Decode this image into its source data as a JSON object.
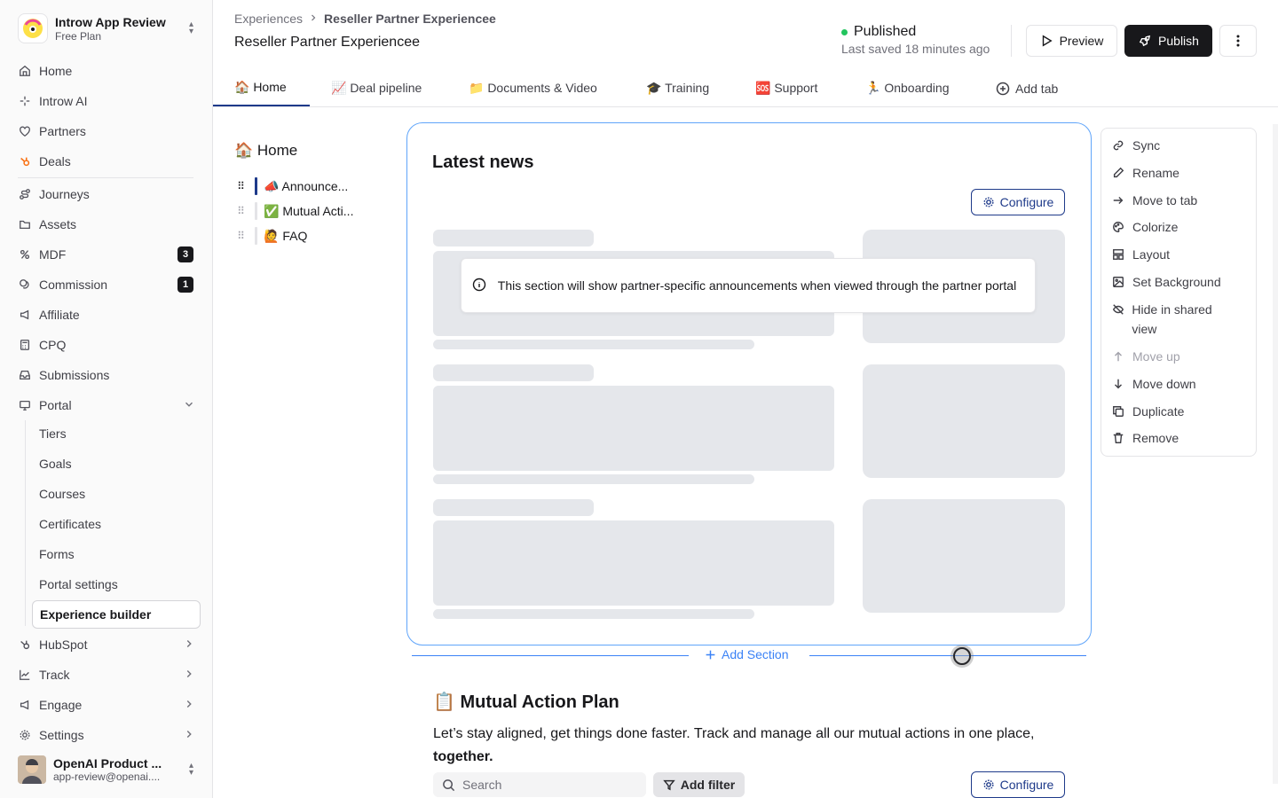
{
  "workspace": {
    "name": "Introw App Review",
    "plan": "Free Plan"
  },
  "nav": {
    "home": "Home",
    "ai": "Introw AI",
    "partners": "Partners",
    "deals": "Deals",
    "journeys": "Journeys",
    "assets": "Assets",
    "mdf": "MDF",
    "mdf_badge": "3",
    "commission": "Commission",
    "commission_badge": "1",
    "affiliate": "Affiliate",
    "cpq": "CPQ",
    "submissions": "Submissions",
    "portal": "Portal",
    "portal_sub": [
      "Tiers",
      "Goals",
      "Courses",
      "Certificates",
      "Forms",
      "Portal settings",
      "Experience builder"
    ],
    "hubspot": "HubSpot",
    "track": "Track",
    "engage": "Engage",
    "settings": "Settings"
  },
  "user": {
    "name": "OpenAI Product ...",
    "email": "app-review@openai...."
  },
  "header": {
    "breadcrumb_root": "Experiences",
    "breadcrumb_current": "Reseller Partner Experiencee",
    "title": "Reseller Partner Experiencee",
    "status": "Published",
    "last_saved": "Last saved 18 minutes ago",
    "preview": "Preview",
    "publish": "Publish"
  },
  "tabs": [
    "🏠 Home",
    "📈 Deal pipeline",
    "📁 Documents & Video",
    "🎓 Training",
    "🆘 Support",
    "🏃 Onboarding"
  ],
  "add_tab": "Add tab",
  "outline": {
    "title": "🏠 Home",
    "items": [
      "📣 Announce...",
      "✅ Mutual Acti...",
      "🙋 FAQ"
    ]
  },
  "news": {
    "title": "Latest news",
    "configure": "Configure",
    "notice": "This section will show partner-specific announcements when viewed through the partner portal"
  },
  "add_section": "Add Section",
  "action_plan": {
    "title": "📋 Mutual Action Plan",
    "desc_prefix": "Let’s stay aligned, get things done faster. Track and manage all our mutual actions in one place, ",
    "desc_bold": "together.",
    "search_placeholder": "Search",
    "add_filter": "Add filter",
    "configure": "Configure"
  },
  "context_menu": [
    "Sync",
    "Rename",
    "Move to tab",
    "Colorize",
    "Layout",
    "Set Background",
    "Hide in shared view",
    "Move up",
    "Move down",
    "Duplicate",
    "Remove"
  ],
  "colors": {
    "accent": "#1e3a8a",
    "section_border": "#60a5fa",
    "published": "#22c55e",
    "dark": "#18181b"
  }
}
